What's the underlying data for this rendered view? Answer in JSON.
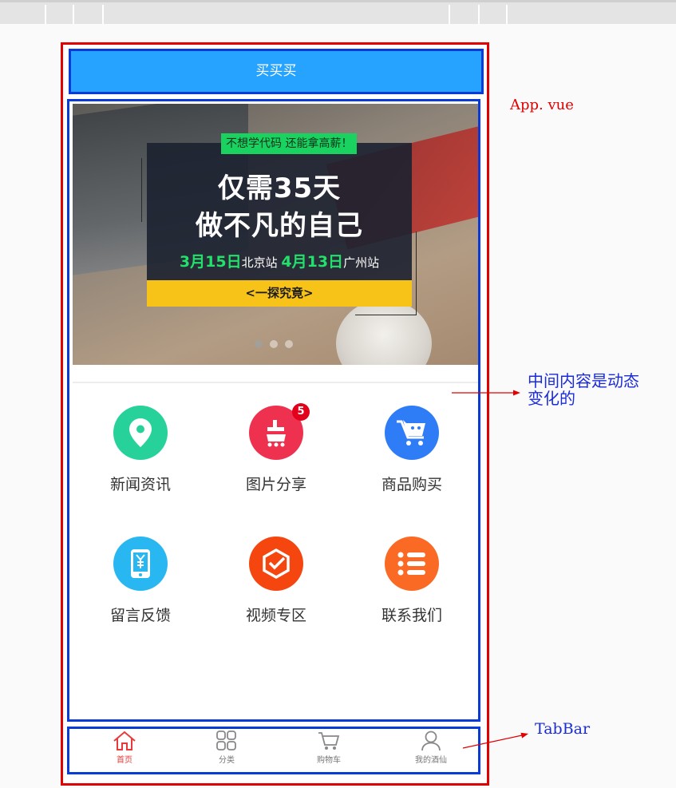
{
  "header": {
    "title": "买买买"
  },
  "banner": {
    "tagline": "不想学代码 还能拿高薪！",
    "line1": "仅需35天",
    "line2": "做不凡的自己",
    "date1": "3月15日",
    "city1": "北京站",
    "date2": "4月13日",
    "city2": "广州站",
    "cta": "<一探究竟>",
    "slide_count": 3,
    "active_slide": 1
  },
  "grid": {
    "items": [
      {
        "label": "新闻资讯",
        "icon": "location-pin-icon",
        "color": "#26d29a"
      },
      {
        "label": "图片分享",
        "icon": "dianping-icon",
        "color": "#ef3150",
        "badge": "5"
      },
      {
        "label": "商品购买",
        "icon": "shopping-cart-icon",
        "color": "#2e7cf6"
      },
      {
        "label": "留言反馈",
        "icon": "phone-yuan-icon",
        "color": "#28b7f0"
      },
      {
        "label": "视频专区",
        "icon": "check-hexagon-icon",
        "color": "#f5460f"
      },
      {
        "label": "联系我们",
        "icon": "list-icon",
        "color": "#fb6a24"
      }
    ]
  },
  "tabbar": {
    "tabs": [
      {
        "label": "首页",
        "icon": "home-icon",
        "active": true
      },
      {
        "label": "分类",
        "icon": "grid-icon",
        "active": false
      },
      {
        "label": "购物车",
        "icon": "cart-icon",
        "active": false
      },
      {
        "label": "我的酒仙",
        "icon": "user-icon",
        "active": false
      }
    ]
  },
  "annotations": {
    "app": "App. vue",
    "middle_line1": "中间内容是动态",
    "middle_line2": "变化的",
    "tabbar": "TabBar"
  },
  "colors": {
    "header_bg": "#26a2ff",
    "outline_red": "#e00000",
    "outline_blue": "#0a3bd6",
    "tab_active": "#e83a3a"
  }
}
